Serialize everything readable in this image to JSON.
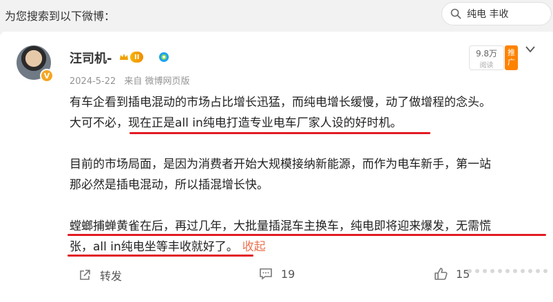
{
  "search_hint": "为您搜索到以下微博：",
  "search": {
    "query": "纯电 丰收"
  },
  "post": {
    "username": "汪司机-",
    "level_badge": "II",
    "avatar_badge": "V",
    "date": "2024-5-22",
    "source": "来自 微博网页版",
    "reads": {
      "count": "9.8万",
      "label": "阅读"
    },
    "promote": [
      "推",
      "广"
    ],
    "paragraphs": [
      "有车企看到插电混动的市场占比增长迅猛，而纯电增长缓慢，动了做增程的念头。",
      "大可不必，现在正是all in纯电打造专业电车厂家人设的好时机。",
      "目前的市场局面，是因为消费者开始大规模接纳新能源，而作为电车新手，第一站",
      "那必然是插电混动，所以插混增长快。",
      "螳螂捕蝉黄雀在后，再过几年，大批量插混车主换车，纯电即将迎来爆发，无需慌",
      "张，all in纯电坐等丰收就好了。"
    ],
    "collapse": "收起",
    "actions": {
      "repost": "转发",
      "comments": "19",
      "likes": "15"
    }
  },
  "colors": {
    "highlight_line": "#e21b23",
    "collapse_link": "#eb7350",
    "promote_bg": "#ff8200"
  },
  "icons": [
    "search-icon",
    "crown-icon",
    "verified-icon",
    "chevron-down-icon",
    "share-icon",
    "comment-icon",
    "like-icon"
  ]
}
